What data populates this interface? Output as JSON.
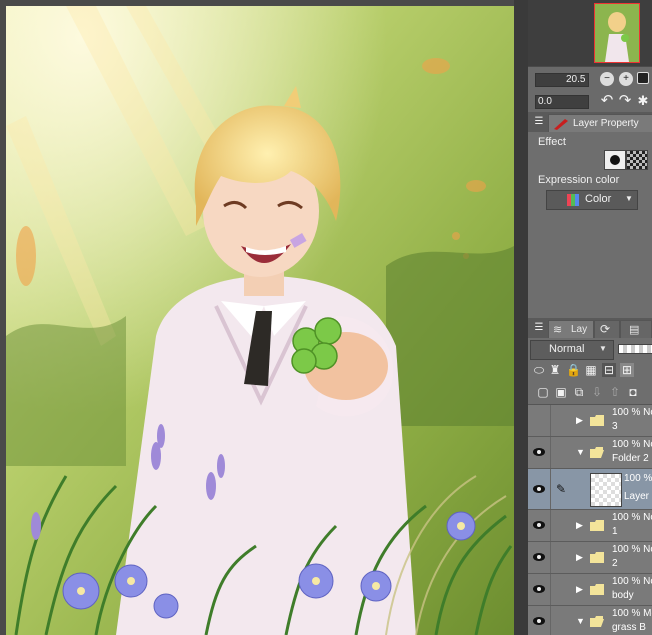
{
  "navigator": {
    "zoom_value": "20.5",
    "rotate_value": "0.0"
  },
  "layer_property": {
    "tab_label": "Layer Property",
    "effect_label": "Effect",
    "expression_color_label": "Expression color",
    "expression_color_value": "Color"
  },
  "layer_panel": {
    "tab_label": "Lay",
    "blend_mode": "Normal",
    "layers": [
      {
        "opacity": "100 % No",
        "name": "3",
        "type": "folder",
        "expanded": false,
        "visible": false,
        "selected": false
      },
      {
        "opacity": "100 % No",
        "name": "Folder 2",
        "type": "folder",
        "expanded": true,
        "visible": true,
        "selected": false
      },
      {
        "opacity": "100 %",
        "name": "Layer",
        "type": "raster",
        "expanded": false,
        "visible": true,
        "selected": true
      },
      {
        "opacity": "100 % No",
        "name": "1",
        "type": "folder",
        "expanded": false,
        "visible": true,
        "selected": false
      },
      {
        "opacity": "100 % No",
        "name": "2",
        "type": "folder",
        "expanded": false,
        "visible": true,
        "selected": false
      },
      {
        "opacity": "100 % No",
        "name": "body",
        "type": "folder",
        "expanded": false,
        "visible": true,
        "selected": false
      },
      {
        "opacity": "100 % Mo",
        "name": "grass B",
        "type": "folder",
        "expanded": true,
        "visible": true,
        "selected": false
      }
    ]
  },
  "colors": {
    "panel_bg": "#6e6e6e",
    "selected_row": "#8896a6",
    "navigator_frame": "#e33333"
  },
  "icons": [
    "zoom-out-icon",
    "zoom-in-icon",
    "fit-icon",
    "rotate-left-icon",
    "rotate-right-icon",
    "reset-icon",
    "eye-icon",
    "folder-icon",
    "pen-icon"
  ]
}
